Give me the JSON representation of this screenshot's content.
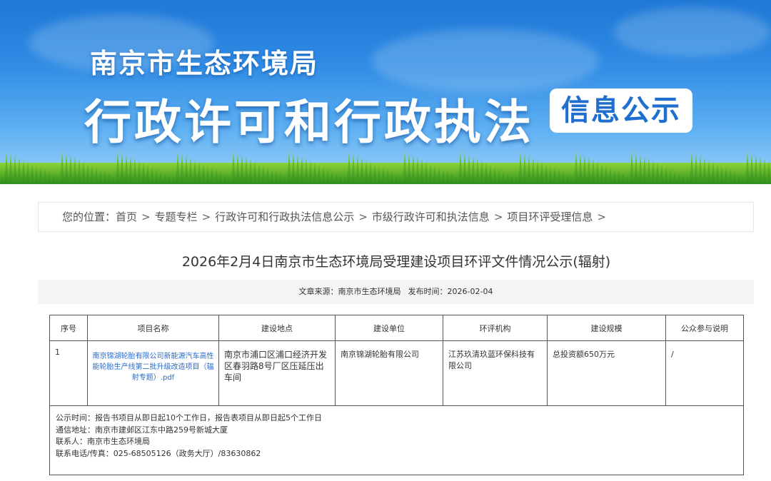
{
  "banner": {
    "org": "南京市生态环境局",
    "headline": "行政许可和行政执法",
    "badge": "信息公示"
  },
  "breadcrumb": {
    "prefix": "您的位置：",
    "items": [
      "首页",
      "专题专栏",
      "行政许可和行政执法信息公示",
      "市级行政许可和执法信息",
      "项目环评受理信息"
    ],
    "separator": ">"
  },
  "article": {
    "title": "2026年2月4日南京市生态环境局受理建设项目环评文件情况公示(辐射)",
    "source_label": "文章来源：",
    "source": "南京市生态环境局",
    "date_label": "发布时间：",
    "date": "2026-02-04"
  },
  "table": {
    "headers": [
      "序号",
      "项目名称",
      "建设地点",
      "建设单位",
      "环评机构",
      "建设规模",
      "公众参与说明"
    ],
    "rows": [
      {
        "index": "1",
        "project": "南京锦湖轮胎有限公司新能源汽车高性能轮胎生产线第二批升级改造项目（辐射专题）.pdf",
        "location": "南京市浦口区浦口经济开发区春羽路8号厂区压延压出车间",
        "builder": "南京锦湖轮胎有限公司",
        "agency": "江苏玖清玖蓝环保科技有限公司",
        "scale": "总投资额650万元",
        "public": "/"
      }
    ],
    "notes": [
      "公示时间：报告书项目从即日起10个工作日，报告表项目从即日起5个工作日",
      "通信地址：南京市建邺区江东中路259号新城大厦",
      "联系人：南京市生态环境局",
      "联系电话/传真：025-68505126（政务大厅）/83630862"
    ]
  }
}
